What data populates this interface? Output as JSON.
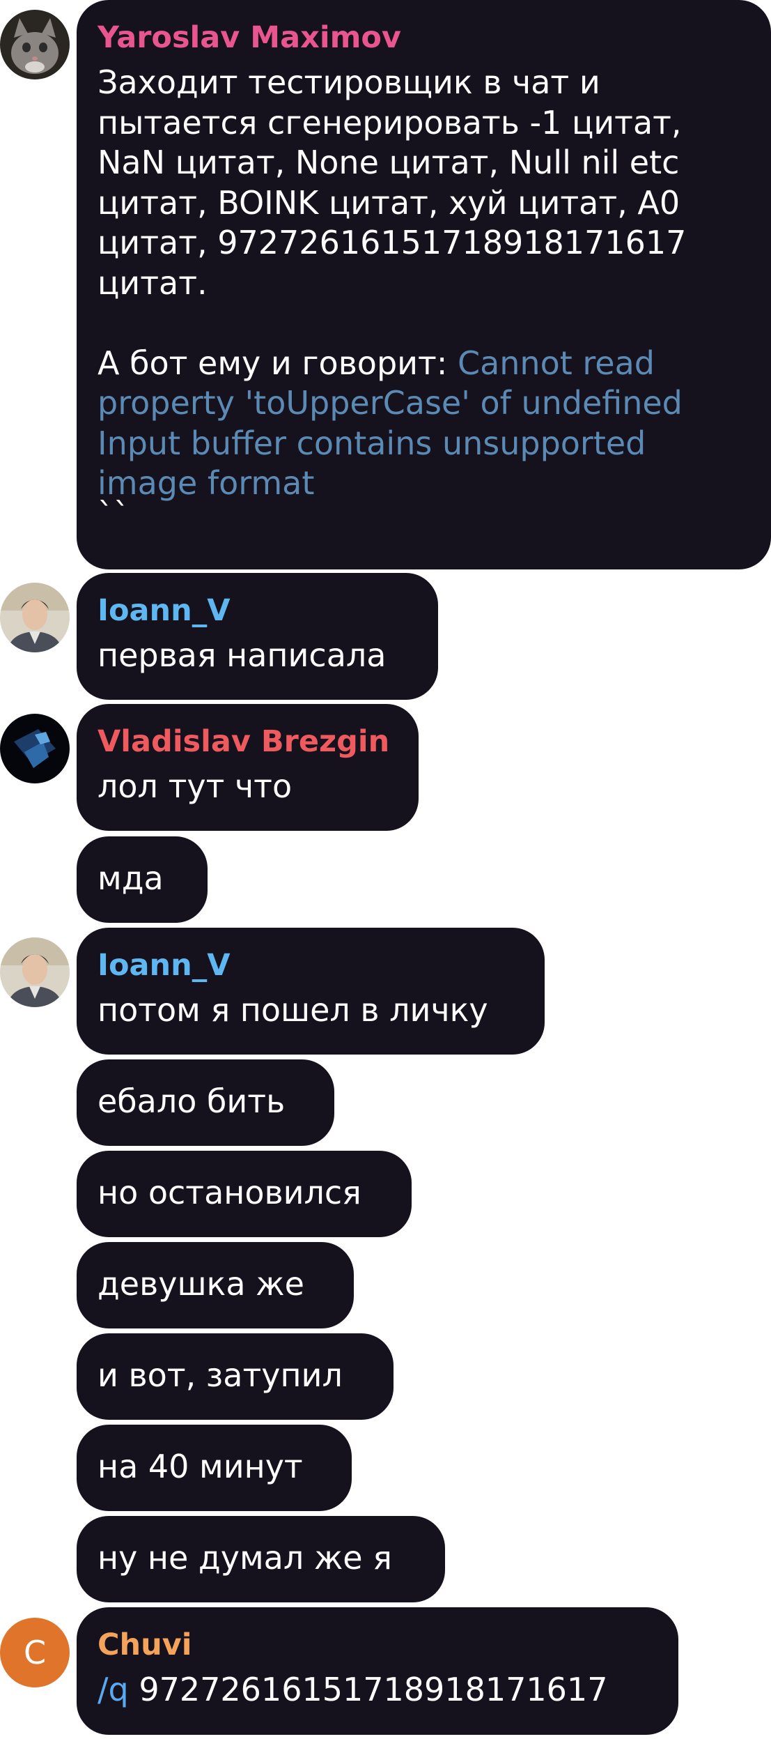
{
  "messages": [
    {
      "author": "Yaroslav Maximov",
      "author_color": "#e8558f",
      "lines": [
        "Заходит тестировщик в чат и",
        "пытается сгенерировать -1 цитат,",
        "NaN цитат, None цитат, Null nil etc",
        "цитат, BOINK цитат, хуй цитат, A0",
        "цитат, 97272616151718918171617",
        "цитат."
      ],
      "reply_prefix": "А бот ему и говорит: ",
      "error_lines": [
        "Cannot read",
        "property 'toUpperCase' of undefined",
        "Input buffer contains unsupported",
        "image format"
      ],
      "trailing": "``"
    },
    {
      "author": "Ioann_V",
      "author_color": "#5fb7f2",
      "text": "первая написала"
    },
    {
      "author": "Vladislav Brezgin",
      "author_color": "#ee5a5e",
      "text": "лол тут что"
    },
    {
      "text": "мда"
    },
    {
      "author": "Ioann_V",
      "author_color": "#5fb7f2",
      "text": "потом я пошел в личку"
    },
    {
      "text": "ебало бить"
    },
    {
      "text": "но остановился"
    },
    {
      "text": "девушка же"
    },
    {
      "text": "и вот, затупил"
    },
    {
      "text": "на 40 минут"
    },
    {
      "text": "ну не думал же я"
    },
    {
      "author": "Chuvi",
      "author_color": "#f5a25a",
      "avatar_letter": "C",
      "avatar_color": "#e0742a",
      "command": "/q",
      "text": " 97272616151718918171617"
    }
  ]
}
